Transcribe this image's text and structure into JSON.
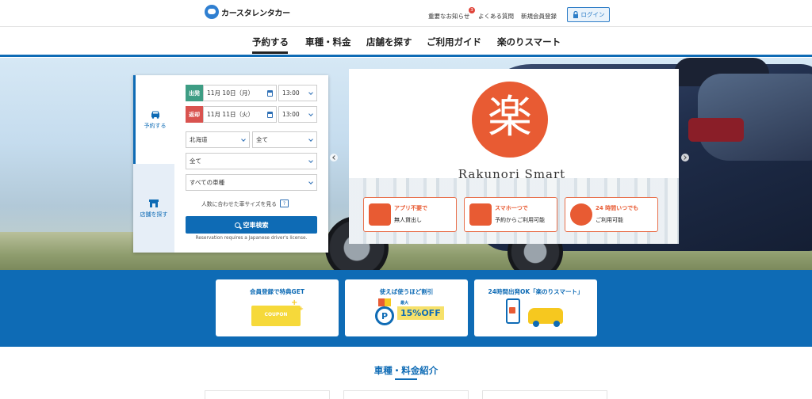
{
  "header": {
    "logo_text": "カースタレンタカー",
    "notice_label": "重要なお知らせ",
    "notice_count": "3",
    "faq_label": "よくある質問",
    "signup_label": "新規会員登録",
    "login_label": "ログイン"
  },
  "nav": {
    "items": [
      {
        "label": "予約する",
        "active": true
      },
      {
        "label": "車種・料金"
      },
      {
        "label": "店舗を探す"
      },
      {
        "label": "ご利用ガイド"
      },
      {
        "label": "楽のりスマート"
      }
    ]
  },
  "booking": {
    "tab_reserve": "予約する",
    "tab_store": "店舗を探す",
    "depart_label": "出発",
    "depart_date": "11月 10日（月）",
    "depart_time": "13:00",
    "return_label": "返却",
    "return_date": "11月 11日（火）",
    "return_time": "13:00",
    "prefecture": "北海道",
    "area": "全て",
    "store": "全て",
    "car_class": "すべての車種",
    "size_hint": "人数に合わせた車サイズを見る",
    "size_hint_icon": "?",
    "search_label": "空車検索",
    "license_note": "Reservation requires a Japanese driver's license."
  },
  "promo": {
    "glyph": "楽",
    "brand": "Rakunori Smart",
    "features": [
      {
        "line1": "アプリ不要で",
        "line2": "無人貸出し",
        "icon": "raku-icon"
      },
      {
        "line1": "スマホ一つで",
        "line2": "予約からご利用可能",
        "icon": "smartphone-icon"
      },
      {
        "line1": "24 時間いつでも",
        "line2": "ご利用可能",
        "icon": "clock-icon"
      }
    ]
  },
  "cards": [
    {
      "title": "会員登録で特典GET",
      "art_text": "COUPON"
    },
    {
      "title": "使えば使うほど割引",
      "art_text": "15%OFF",
      "art_small": "最大",
      "art_symbol": "P"
    },
    {
      "title": "24時間出発OK「楽のりスマート」"
    }
  ],
  "section": {
    "title": "車種・料金紹介"
  },
  "colors": {
    "brand_blue": "#0e6bb5",
    "accent_orange": "#e85b33",
    "depart_green": "#3e9d84",
    "return_red": "#d9534f"
  }
}
